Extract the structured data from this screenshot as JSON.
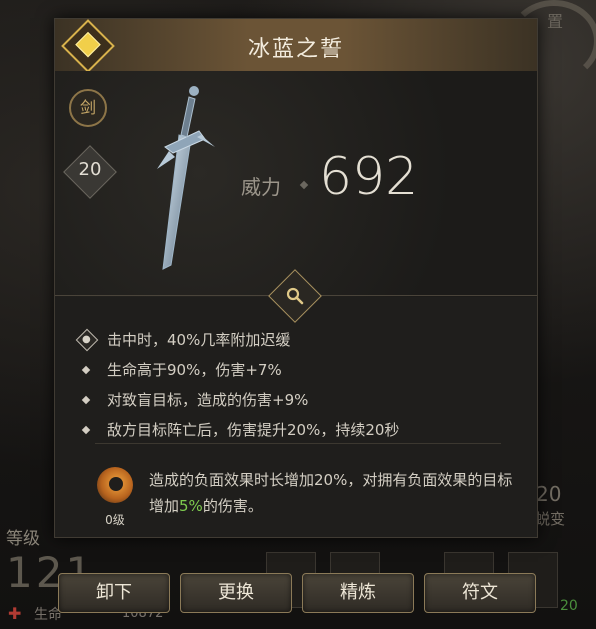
{
  "item": {
    "name": "冰蓝之誓",
    "type_badge": "剑",
    "level": "20",
    "power_label": "威力",
    "power_value": "692"
  },
  "affixes": [
    {
      "text": "击中时，40%几率附加迟缓",
      "icon": "lock-icon"
    },
    {
      "text": "生命高于90%，伤害+7%",
      "icon": "diamond-bullet-icon"
    },
    {
      "text": "对致盲目标，造成的伤害+9%",
      "icon": "diamond-bullet-icon"
    },
    {
      "text": "敌方目标阵亡后，伤害提升20%，持续20秒",
      "icon": "diamond-bullet-icon"
    }
  ],
  "set_bonus": {
    "level_label": "0级",
    "desc_before": "造成的负面效果时长增加20%，对拥有负面效果的目标增加",
    "desc_highlight": "5%",
    "desc_after": "的伤害。"
  },
  "actions": {
    "unequip": "卸下",
    "replace": "更换",
    "refine": "精炼",
    "rune": "符文"
  },
  "background": {
    "level_label": "等级",
    "level_value": "121",
    "hp_label": "生命",
    "hp_value": "10872",
    "right_value": "20",
    "right_label": "蜕变",
    "right_top": "置",
    "right_bottom": "20"
  },
  "colors": {
    "highlight": "#7ecb4f",
    "header_gold": "#6b5436",
    "rarity_gold": "#f1cf4a"
  }
}
